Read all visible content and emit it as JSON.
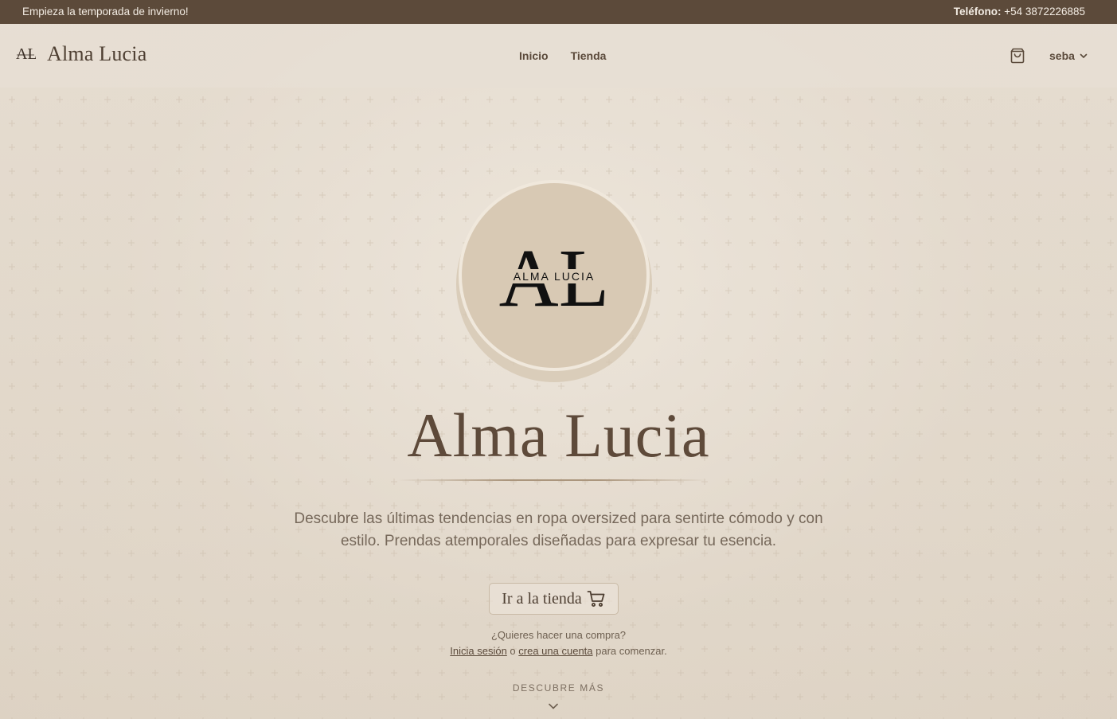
{
  "topbar": {
    "promo": "Empieza la temporada de invierno!",
    "phone_label": "Teléfono:",
    "phone_value": "+54 3872226885"
  },
  "header": {
    "brand_name": "Alma Lucia",
    "brand_mark_text": "AL",
    "nav": [
      "Inicio",
      "Tienda"
    ],
    "cart_icon": "shopping-bag-icon",
    "user_name": "seba",
    "user_chevron_icon": "chevron-down-icon"
  },
  "hero": {
    "logo_letters": "AL",
    "logo_text": "ALMA LUCIA",
    "title": "Alma Lucia",
    "description": "Descubre las últimas tendencias en ropa oversized para sentirte cómodo y con estilo. Prendas atemporales diseñadas para expresar tu esencia.",
    "shop_button": "Ir a la tienda",
    "shop_button_icon": "shopping-cart-icon",
    "login_question": "¿Quieres hacer una compra?",
    "login_link": "Inicia sesión",
    "login_or": " o ",
    "register_link": "crea una cuenta",
    "login_suffix": " para comenzar.",
    "discover": "DESCUBRE MÁS",
    "discover_icon": "chevron-down-icon"
  },
  "colors": {
    "topbar_bg": "#5c4a3a",
    "page_bg": "#e3d9cc",
    "accent": "#5e4a3a",
    "logo_circle": "#d8c9b4"
  }
}
